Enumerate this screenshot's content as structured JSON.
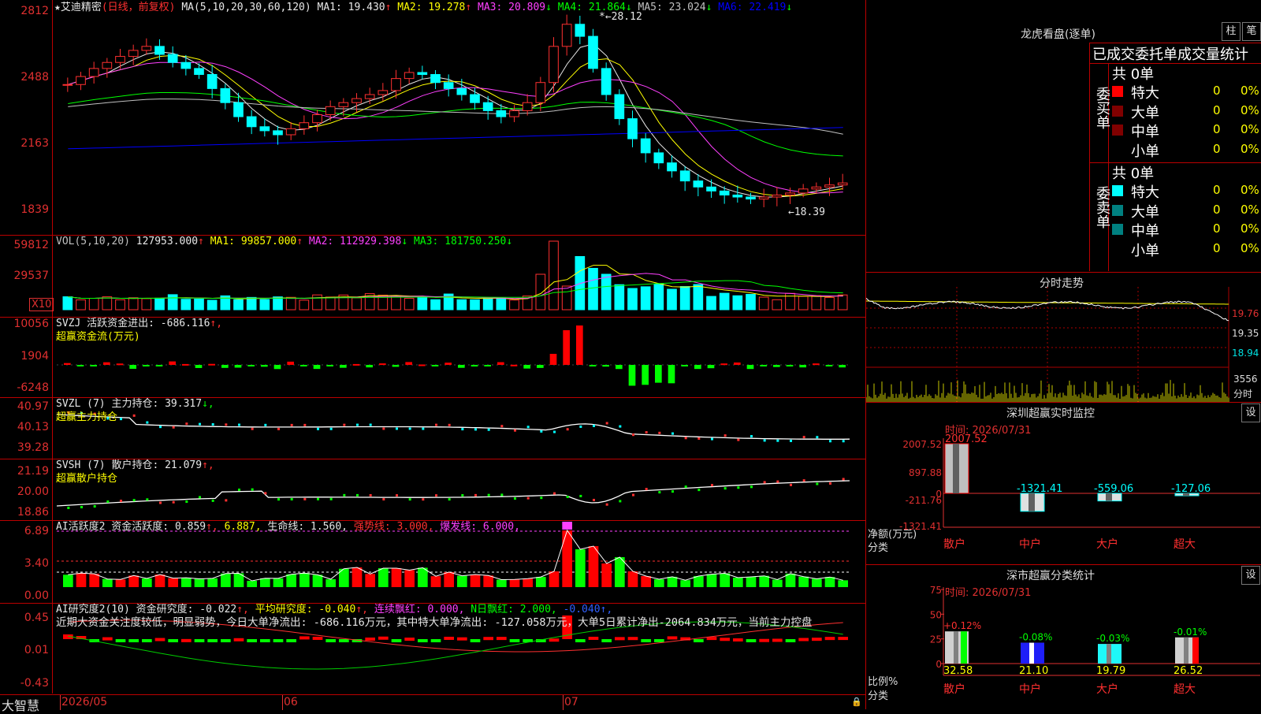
{
  "brand": "大智慧",
  "main": {
    "title": "艾迪精密",
    "title_note": "(日线，前复权)",
    "ma_label": "MA(5,10,20,30,60,120)",
    "ma": [
      {
        "label": "MA1: 19.430",
        "dir": "↑",
        "color": "#e8e8e8"
      },
      {
        "label": "MA2: 19.278",
        "dir": "↑",
        "color": "#ffff00"
      },
      {
        "label": "MA3: 20.809",
        "dir": "↓",
        "color": "#ff40ff"
      },
      {
        "label": "MA4: 21.864",
        "dir": "↓",
        "color": "#00ff00"
      },
      {
        "label": "MA5: 23.024",
        "dir": "↓",
        "color": "#c0c0c0"
      },
      {
        "label": "MA6: 22.419",
        "dir": "↓",
        "color": "#0000ff"
      }
    ],
    "yticks": [
      "2812",
      "2488",
      "2163",
      "1839"
    ],
    "high_label": "28.12",
    "low_label": "18.39"
  },
  "vol": {
    "label": "VOL(5,10,20)",
    "value": "127953.000",
    "value_dir": "↑",
    "ma": [
      {
        "label": "MA1: 99857.000",
        "dir": "↑",
        "color": "#ffff00"
      },
      {
        "label": "MA2: 112929.398",
        "dir": "↓",
        "color": "#ff40ff"
      },
      {
        "label": "MA3: 181750.250",
        "dir": "↓",
        "color": "#00ff00"
      }
    ],
    "yticks": [
      "59812",
      "29537"
    ],
    "unit_box": "X10"
  },
  "svzj": {
    "label": "SVZJ  活跃资金进出: -686.116",
    "dir": "↑,",
    "sub": "超赢资金流(万元)",
    "yticks": [
      "10056",
      "1904",
      "-6248"
    ]
  },
  "svzl": {
    "label": "SVZL (7) 主力持仓: 39.317",
    "dir": "↓,",
    "sub": "超赢主力持仓",
    "yticks": [
      "40.97",
      "40.13",
      "39.28"
    ]
  },
  "svsh": {
    "label": "SVSH (7) 散户持仓: 21.079",
    "dir": "↑,",
    "sub": "超赢散户持仓",
    "yticks": [
      "21.19",
      "20.00",
      "18.86"
    ]
  },
  "ai_active": {
    "label": "AI活跃度2 资金活跃度: 0.859",
    "v2": "6.887,",
    "life": "生命线: 1.560,",
    "strong": "强势线: 3.000,",
    "burst": "爆发线: 6.000,",
    "yticks": [
      "6.89",
      "3.40",
      "0.00"
    ]
  },
  "ai_research": {
    "label": "AI研究度2(10) 资金研究度: -0.022",
    "avg": "平均研究度: -0.040",
    "red_streak": "连续飘红: 0.000,",
    "n_red": "N日飘红: 2.000,",
    "last": "-0.040",
    "comment": "近期大资金关注度较低，明显弱势，今日大单净流出: -686.116万元，其中特大单净流出: -127.058万元，大单5日累计净出-2064.834万元，当前主力控盘",
    "yticks": [
      "0.45",
      "0.01",
      "-0.43"
    ]
  },
  "dates": [
    "2026/05",
    "06",
    "07"
  ],
  "side": {
    "title": "龙虎看盘(逐单)",
    "btn1": "柱",
    "btn2": "笔",
    "tabs": [
      "已成交",
      "委托单",
      "成交量统计"
    ],
    "buy_group": "委买单",
    "sell_group": "委卖单",
    "total": "共 0单",
    "rows": [
      "特大",
      "大单",
      "中单",
      "小单"
    ],
    "row_value": "0",
    "row_pct": "0%",
    "buy_colors": [
      "#ff0000",
      "#800000",
      "#800000",
      "#000000"
    ],
    "sell_colors": [
      "#00ffff",
      "#008080",
      "#008080",
      "#000000"
    ]
  },
  "intraday": {
    "title": "分时走势",
    "yticks": [
      "19.76",
      "19.35",
      "18.94"
    ],
    "vol_tick": "3556",
    "vol_unit": "分时"
  },
  "sz_monitor": {
    "title": "深圳超赢实时监控",
    "btn": "设",
    "time": "时间: 2026/07/31",
    "yticks": [
      "2007.52",
      "897.88",
      "0",
      "-211.76",
      "-1321.41"
    ],
    "ylabel": "净额(万元)",
    "xlabel": "分类",
    "categories": [
      "散户",
      "中户",
      "大户",
      "超大"
    ],
    "values": [
      2007.52,
      -1321.41,
      -559.06,
      -127.06
    ],
    "value_labels": [
      "2007.52",
      "-1321.41",
      "-559.06",
      "-127.06"
    ]
  },
  "sz_class": {
    "title": "深市超赢分类统计",
    "btn": "设",
    "time": "时间: 2026/07/31",
    "yticks": [
      "75",
      "50",
      "25",
      "0"
    ],
    "ylabel": "比例%",
    "xlabel": "分类",
    "categories": [
      "散户",
      "中户",
      "大户",
      "超大"
    ],
    "values": [
      32.58,
      21.1,
      19.79,
      26.52
    ],
    "changes": [
      "+0.12%",
      "-0.08%",
      "-0.03%",
      "-0.01%"
    ]
  }
}
